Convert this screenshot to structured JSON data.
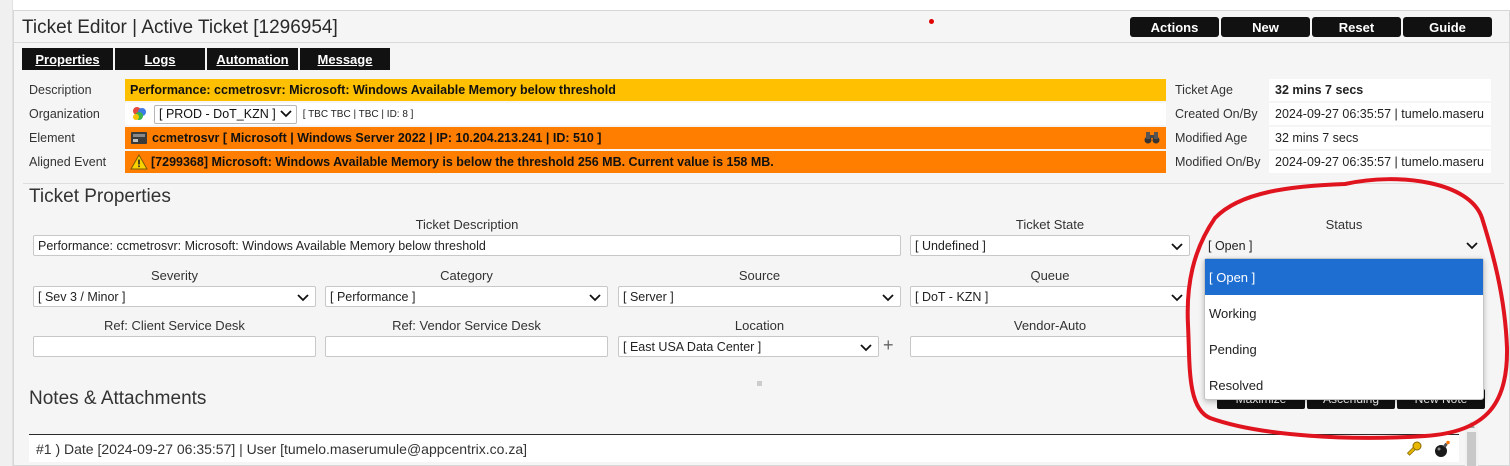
{
  "title": "Ticket Editor | Active Ticket [1296954]",
  "actions": [
    "Actions",
    "New",
    "Reset",
    "Guide"
  ],
  "tabs": [
    "Properties",
    "Logs",
    "Automation",
    "Message"
  ],
  "info": {
    "description_label": "Description",
    "description_value": "Performance: ccmetrosvr: Microsoft: Windows Available Memory below threshold",
    "organization_label": "Organization",
    "organization_value": "[ PROD - DoT_KZN ]",
    "organization_extra": "[ TBC TBC | TBC | ID: 8 ]",
    "element_label": "Element",
    "element_value": "ccmetrosvr [ Microsoft | Windows Server 2022 | IP: 10.204.213.241 | ID: 510 ]",
    "aligned_label": "Aligned Event",
    "aligned_value": "[7299368] Microsoft: Windows Available Memory is below the threshold 256 MB. Current value is 158 MB."
  },
  "right_info": {
    "ticket_age_label": "Ticket Age",
    "ticket_age_value": "32 mins 7 secs",
    "created_label": "Created On/By",
    "created_value": "2024-09-27 06:35:57 | tumelo.maseru",
    "modified_age_label": "Modified Age",
    "modified_age_value": "32 mins 7 secs",
    "modified_on_label": "Modified On/By",
    "modified_on_value": "2024-09-27 06:35:57 | tumelo.maseru"
  },
  "props": {
    "section_title": "Ticket Properties",
    "ticket_description_label": "Ticket Description",
    "ticket_description_value": "Performance: ccmetrosvr: Microsoft: Windows Available Memory below threshold",
    "ticket_state_label": "Ticket State",
    "ticket_state_value": "[ Undefined ]",
    "status_label": "Status",
    "status_value": "[ Open ]",
    "severity_label": "Severity",
    "severity_value": "[ Sev 3 / Minor ]",
    "category_label": "Category",
    "category_value": "[ Performance ]",
    "source_label": "Source",
    "source_value": "[ Server ]",
    "queue_label": "Queue",
    "queue_value": "[ DoT - KZN ]",
    "ref_client_label": "Ref: Client Service Desk",
    "ref_client_value": "",
    "ref_vendor_label": "Ref: Vendor Service Desk",
    "ref_vendor_value": "",
    "location_label": "Location",
    "location_value": "[ East USA Data Center ]",
    "vendor_auto_label": "Vendor-Auto",
    "vendor_auto_value": ""
  },
  "status_dropdown": {
    "options": [
      "[ Open ]",
      "Working",
      "Pending",
      "Resolved"
    ],
    "selected": "[ Open ]"
  },
  "notes": {
    "section_title": "Notes & Attachments",
    "buttons": [
      "Maximize",
      "Ascending",
      "New Note"
    ],
    "first_note": "#1 ) Date [2024-09-27 06:35:57] | User [tumelo.maserumule@appcentrix.co.za]"
  },
  "colors": {
    "description_bg": "#fec000",
    "element_bg": "#ff7e00",
    "dropdown_selected": "#1e6ed1",
    "annotation_red": "#e0141e"
  }
}
